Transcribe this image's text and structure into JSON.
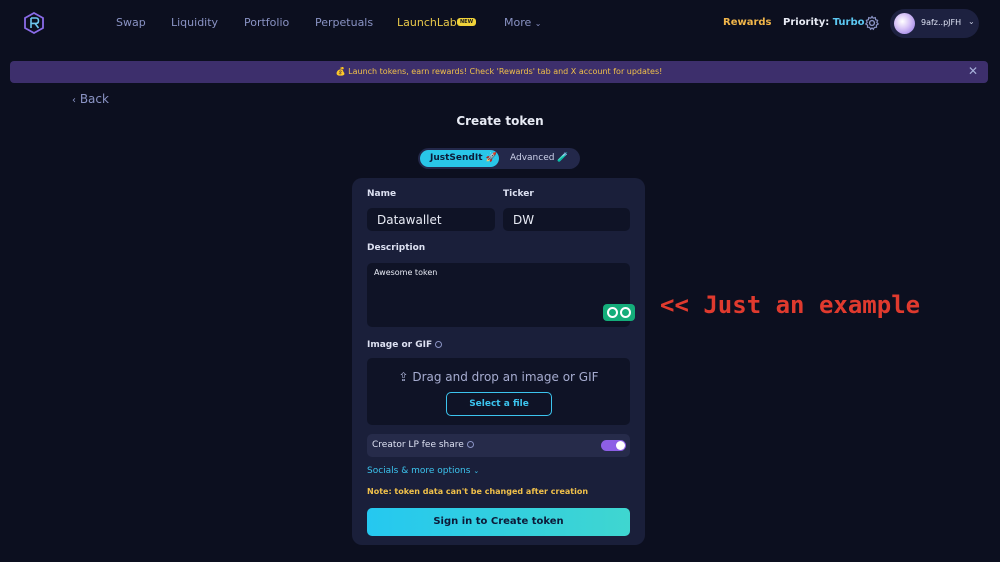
{
  "nav": {
    "logo_icon": "raydium-logo-icon",
    "links": [
      "Swap",
      "Liquidity",
      "Portfolio",
      "Perpetuals",
      "LaunchLab",
      "More"
    ],
    "launch_badge": "NEW",
    "rewards": "Rewards",
    "priority_label": "Priority:",
    "priority_value": "Turbo",
    "wallet_address": "9afz..pJFH",
    "settings_icon": "gear-icon"
  },
  "announcement": {
    "text": "💰 Launch tokens, earn rewards! Check 'Rewards' tab and X account for updates!",
    "close": "✕"
  },
  "back_label": "Back",
  "page_title": "Create token",
  "mode_toggle": {
    "options": [
      "JustSendIt 🚀",
      "Advanced 🧪"
    ],
    "selected": "JustSendIt"
  },
  "form": {
    "name_label": "Name",
    "name_value": "Datawallet",
    "ticker_label": "Ticker",
    "ticker_value": "DW",
    "description_label": "Description",
    "description_value": "Awesome token",
    "image_label": "Image or GIF",
    "drop_text": "Drag and drop an image or GIF",
    "select_file": "Select a file",
    "lp_fee_label": "Creator LP fee share",
    "lp_fee_enabled": true,
    "socials_label": "Socials & more options",
    "note": "Note: token data can't be changed after creation",
    "submit": "Sign in to Create token"
  },
  "annotation": "<< Just an example",
  "colors": {
    "background": "#0c0f1f",
    "accent_cyan": "#29c6e8",
    "accent_gold": "#f0c04a",
    "accent_purple": "#8d5fe6",
    "annotation_red": "#e03a2e"
  }
}
